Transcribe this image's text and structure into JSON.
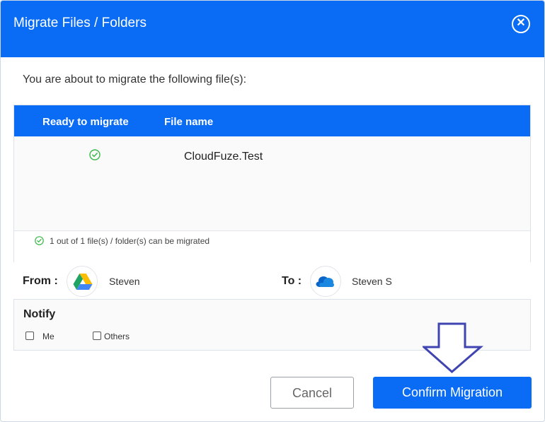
{
  "dialog": {
    "title": "Migrate Files / Folders",
    "close_icon": "close-icon",
    "intro": "You are about to migrate the following file(s):"
  },
  "table": {
    "headers": [
      "Ready to migrate",
      "File name"
    ],
    "rows": [
      {
        "ready_icon": "check-circle-icon",
        "file_name": "CloudFuze.Test"
      }
    ],
    "summary": "1 out of 1 file(s) / folder(s) can be migrated"
  },
  "transfer": {
    "from_label": "From :",
    "from_icon": "google-drive-icon",
    "from_user": "Steven",
    "to_label": "To :",
    "to_icon": "onedrive-icon",
    "to_user": "Steven S"
  },
  "notify": {
    "title": "Notify",
    "options": [
      {
        "label": "Me",
        "checked": false
      },
      {
        "label": "Others",
        "checked": false
      }
    ]
  },
  "buttons": {
    "cancel": "Cancel",
    "confirm": "Confirm Migration"
  },
  "colors": {
    "primary": "#0a6cf5",
    "success": "#3cb84a",
    "arrow": "#3f44b0"
  }
}
